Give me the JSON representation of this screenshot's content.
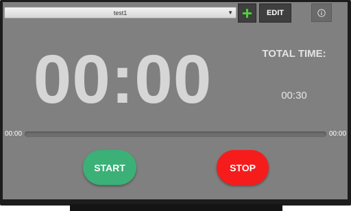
{
  "preset": {
    "selected": "test1",
    "caret_icon": "triangle-down-icon"
  },
  "toolbar": {
    "add_icon": "plus-icon",
    "edit_label": "EDIT",
    "info_icon": "info-icon"
  },
  "timer": {
    "display": "00:00",
    "total_label": "TOTAL TIME:",
    "total_value": "00:30"
  },
  "progress": {
    "elapsed": "00:00",
    "remaining": "00:00",
    "fraction": 0
  },
  "controls": {
    "start_label": "START",
    "stop_label": "STOP"
  },
  "colors": {
    "start": "#3bb077",
    "stop": "#f61c1c",
    "add_icon": "#4cd137",
    "background": "#808080"
  }
}
